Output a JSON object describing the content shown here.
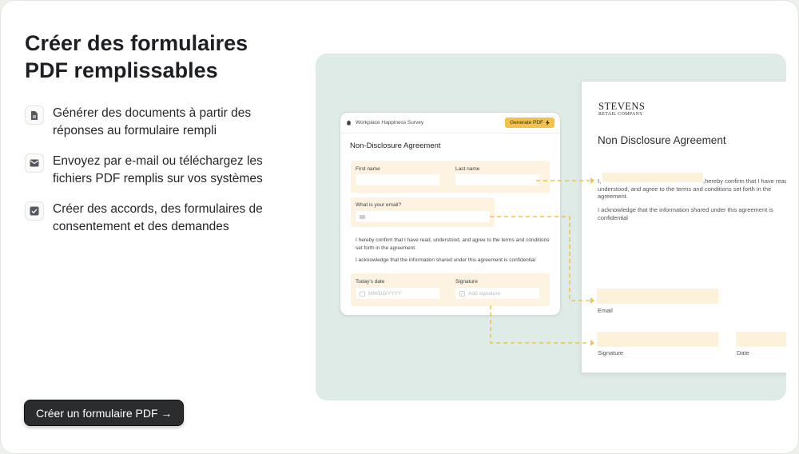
{
  "heading": {
    "line1": "Créer des formulaires",
    "line2": "PDF remplissables"
  },
  "features": [
    {
      "icon": "document-icon",
      "text": "Générer des documents à partir des réponses au formulaire rempli"
    },
    {
      "icon": "envelope-icon",
      "text": "Envoyez par e-mail ou téléchargez les fichiers PDF remplis sur vos systèmes"
    },
    {
      "icon": "checkbox-icon",
      "text": "Créer des accords, des formulaires de consentement et des demandes"
    }
  ],
  "cta": {
    "label": "Créer un formulaire PDF →"
  },
  "form": {
    "survey_title": "Workplace Happiness Survey",
    "generate_label": "Generate PDF",
    "heading": "Non-Disclosure Agreement",
    "first_name": "First name",
    "last_name": "Last name",
    "email_label": "What is your email?",
    "confirm_text": "I hereby confirm that I have read, understood, and agree to the terms and conditions set forth in the agreement.",
    "ack_text": "I acknowledge that the information shared under this agreement is confidential",
    "date_label": "Today's date",
    "date_placeholder": "MM/DD/YYYY",
    "signature_label": "Signature",
    "signature_placeholder": "Add signature"
  },
  "doc": {
    "company_name": "STEVENS",
    "company_sub": "RETAIL COMPANY",
    "title": "Non Disclosure Agreement",
    "i_prefix": "I,",
    "confirm_text": ",hereby confirm that I have read, understood, and agree to the terms and conditions set forth in the agreement.",
    "ack_text": "I acknowledge that the information shared under this agreement is confidential",
    "email_label": "Email",
    "signature_label": "Signature",
    "date_label": "Date"
  },
  "colors": {
    "accent": "#f2c24a",
    "panel": "#dfebe6",
    "field": "#fdf3e0",
    "cta": "#2b2c2e"
  }
}
